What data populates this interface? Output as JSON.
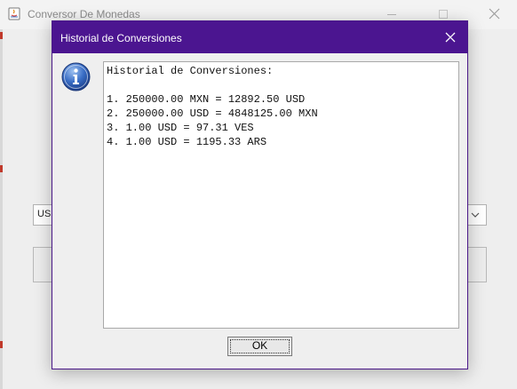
{
  "main_window": {
    "title": "Conversor De Monedas",
    "from_currency": "USD"
  },
  "dialog": {
    "title": "Historial de Conversiones",
    "icon": "info-icon",
    "content": {
      "lines": [
        "Historial de Conversiones:",
        "",
        "1. 250000.00 MXN = 12892.50 USD",
        "2. 250000.00 USD = 4848125.00 MXN",
        "3. 1.00 USD = 97.31 VES",
        "4. 1.00 USD = 1195.33 ARS"
      ]
    },
    "ok_label": "OK"
  },
  "colors": {
    "dialog_titlebar": "#4b1590",
    "info_icon": "#2f5cb5"
  }
}
